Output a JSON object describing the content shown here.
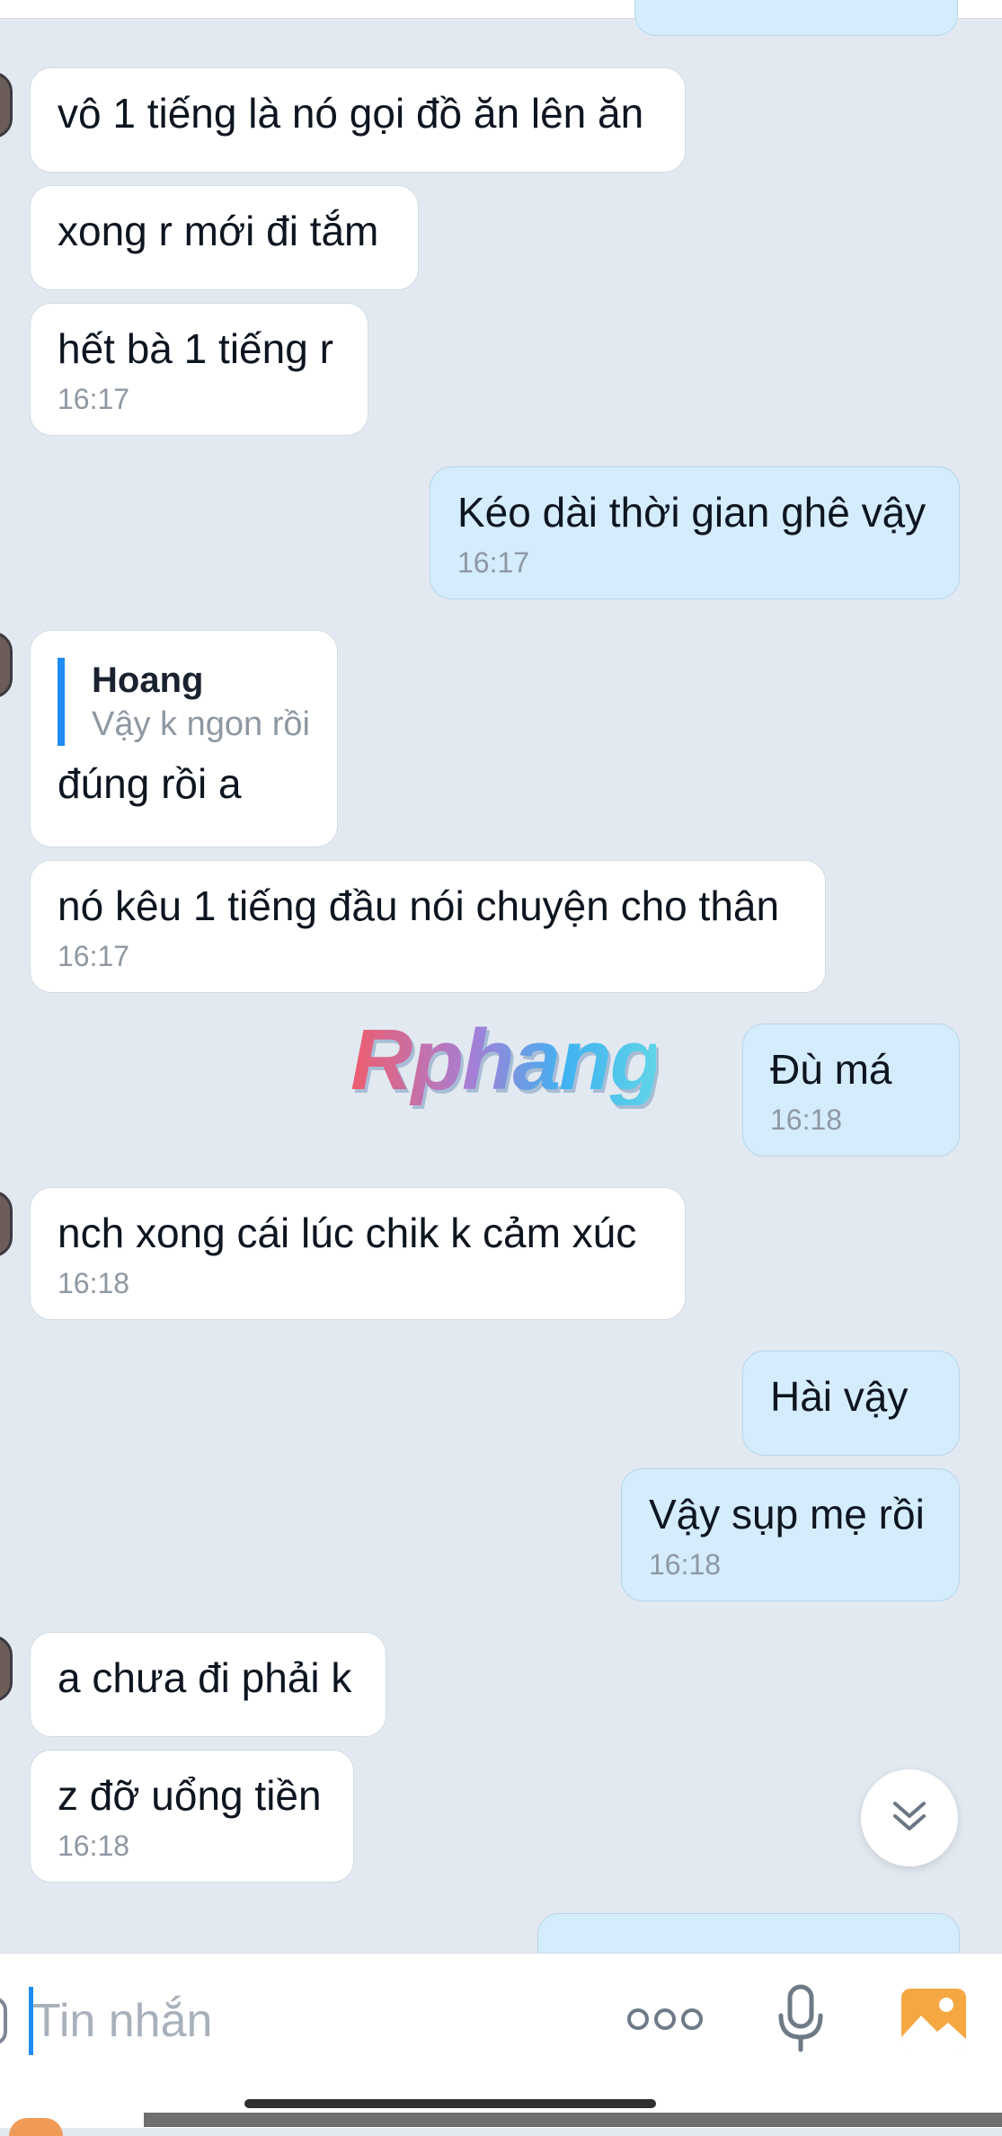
{
  "messages": [
    {
      "direction": "out",
      "text": "",
      "time": ""
    },
    {
      "direction": "in",
      "text": "vô 1 tiếng là nó gọi đồ ăn lên ăn",
      "time": ""
    },
    {
      "direction": "in",
      "text": "xong r mới đi tắm",
      "time": ""
    },
    {
      "direction": "in",
      "text": "hết bà 1 tiếng r",
      "time": "16:17"
    },
    {
      "direction": "out",
      "text": "Kéo dài thời gian ghê vậy",
      "time": "16:17"
    },
    {
      "direction": "in",
      "quote": {
        "name": "Hoang",
        "text": "Vậy k ngon rồi"
      },
      "text": "đúng rồi a",
      "time": ""
    },
    {
      "direction": "in",
      "text": "nó kêu 1 tiếng đầu nói chuyện cho thân",
      "time": "16:17"
    },
    {
      "direction": "out",
      "text": "Đù má",
      "time": "16:18"
    },
    {
      "direction": "in",
      "text": "nch xong cái lúc chik k cảm xúc",
      "time": "16:18"
    },
    {
      "direction": "out",
      "text": "Hài vậy",
      "time": ""
    },
    {
      "direction": "out",
      "text": "Vậy sụp mẹ rồi",
      "time": "16:18"
    },
    {
      "direction": "in",
      "text": "a chưa đi phải k",
      "time": ""
    },
    {
      "direction": "in",
      "text": "z đỡ uổng tiền",
      "time": "16:18"
    },
    {
      "direction": "out",
      "text": "",
      "time": ""
    }
  ],
  "watermark": "Rphang",
  "composer": {
    "placeholder": "Tin nhắn",
    "value": ""
  },
  "icons": {
    "scroll_down": "chevron-double-down-icon",
    "more": "more-dots-icon",
    "voice": "microphone-icon",
    "image": "image-gallery-icon"
  },
  "colors": {
    "background": "#e2e9f1",
    "incoming_bubble": "#ffffff",
    "outgoing_bubble": "#d4ecfb",
    "accent": "#1e8cf0",
    "image_icon": "#f5a742"
  }
}
